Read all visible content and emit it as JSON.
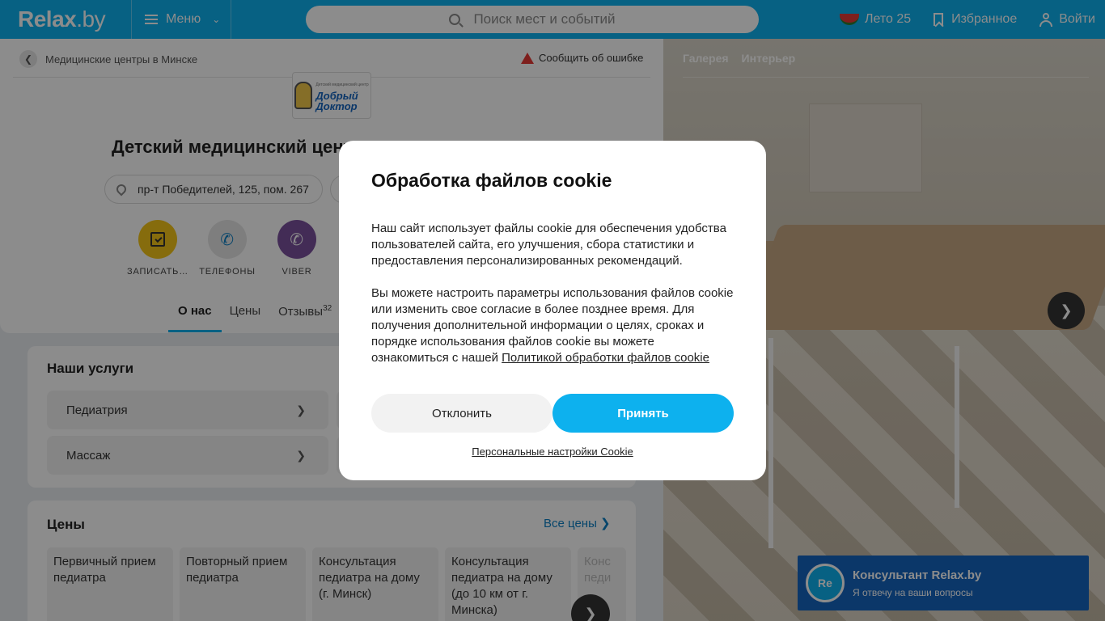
{
  "header": {
    "logo": "Relax",
    "logo_suffix": ".by",
    "menu_label": "Меню",
    "search_placeholder": "Поиск мест и событий",
    "summer_label": "Лето 25",
    "favorites_label": "Избранное",
    "login_label": "Войти"
  },
  "breadcrumb": {
    "label": "Медицинские центры в Минске"
  },
  "report_error": "Сообщить об ошибке",
  "org": {
    "logo_line1": "Добрый",
    "logo_line2": "Доктор",
    "logo_small": "Детский медицинский центр",
    "title": "Детский медицинский центр «Добрый Доктор»",
    "address": "пр-т Победителей, 125, пом. 267"
  },
  "actions": [
    {
      "label": "ЗАПИСАТЬ…",
      "color": "#f5c518"
    },
    {
      "label": "ТЕЛЕФОНЫ",
      "color": "#e6e6e6"
    },
    {
      "label": "VIBER",
      "color": "#7b519d"
    }
  ],
  "tabs": [
    {
      "label": "О нас"
    },
    {
      "label": "Цены"
    },
    {
      "label": "Отзывы",
      "count": "32"
    }
  ],
  "services": {
    "title": "Наши услуги",
    "items": [
      {
        "label": "Педиатрия"
      },
      {
        "label": "Массаж"
      }
    ]
  },
  "prices": {
    "title": "Цены",
    "all_label": "Все цены",
    "cards": [
      {
        "label": "Первичный прием педиатра"
      },
      {
        "label": "Повторный прием педиатра"
      },
      {
        "label": "Консультация педиатра на дому (г. Минск)"
      },
      {
        "label": "Консультация педиатра на дому (до 10 км от г. Минска)"
      },
      {
        "label": "Конс педи"
      }
    ]
  },
  "gallery": {
    "tabs": [
      "Галерея",
      "Интерьер"
    ]
  },
  "consultant": {
    "avatar": "Re",
    "title": "Консультант Relax.by",
    "subtitle": "Я отвечу на ваши вопросы"
  },
  "cookie_modal": {
    "title": "Обработка файлов cookie",
    "para1": "Наш сайт использует файлы cookie для обеспечения удобства пользователей сайта, его улучшения, сбора статистики и предоставления персонализированных рекомендаций.",
    "para2": "Вы можете настроить параметры использования файлов cookie или изменить свое согласие в более позднее время. Для получения дополнительной информации о целях, сроках и порядке использования файлов cookie вы можете ознакомиться с нашей",
    "policy_link": "Политикой обработки файлов cookie",
    "decline_label": "Отклонить",
    "accept_label": "Принять",
    "settings_label": "Персональные настройки Cookie"
  },
  "colors": {
    "brand": "#0db1ee",
    "accent_dark": "#1565c0"
  }
}
